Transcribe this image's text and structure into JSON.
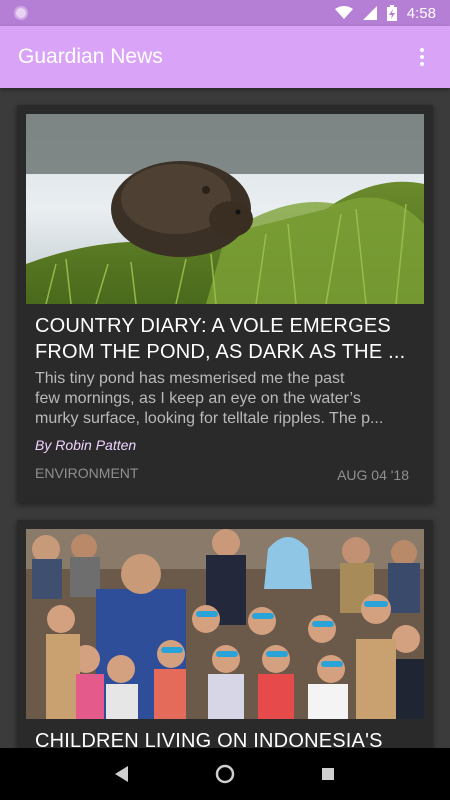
{
  "status": {
    "time": "4:58"
  },
  "app": {
    "title": "Guardian News"
  },
  "articles": [
    {
      "headline_line1": "COUNTRY DIARY: A VOLE EMERGES",
      "headline_line2": "FROM THE POND, AS DARK AS THE ...",
      "trail_line1": "This tiny pond has mesmerised me the past",
      "trail_line2": "few mornings, as I keep an eye on the water’s",
      "trail_line3": "murky surface, looking for telltale ripples. The p...",
      "byline": "By Robin Patten",
      "section": "ENVIRONMENT",
      "date": "AUG 04 '18",
      "image_desc": "vole-in-grass"
    },
    {
      "headline_line1": "CHILDREN LIVING ON INDONESIA'S",
      "image_desc": "group-of-children-with-goggles"
    }
  ],
  "icons": {
    "status_left": "notification-dot-icon",
    "wifi": "wifi-icon",
    "signal": "signal-icon",
    "battery": "battery-charging-icon",
    "overflow": "overflow-menu-icon",
    "back": "back-icon",
    "home": "home-icon",
    "recents": "recents-icon"
  },
  "colors": {
    "status_bar": "#b57fd6",
    "app_bar": "#d9a4f7",
    "background": "#3b3b3b",
    "card": "#2a2a2a",
    "byline": "#f0d3ff"
  }
}
